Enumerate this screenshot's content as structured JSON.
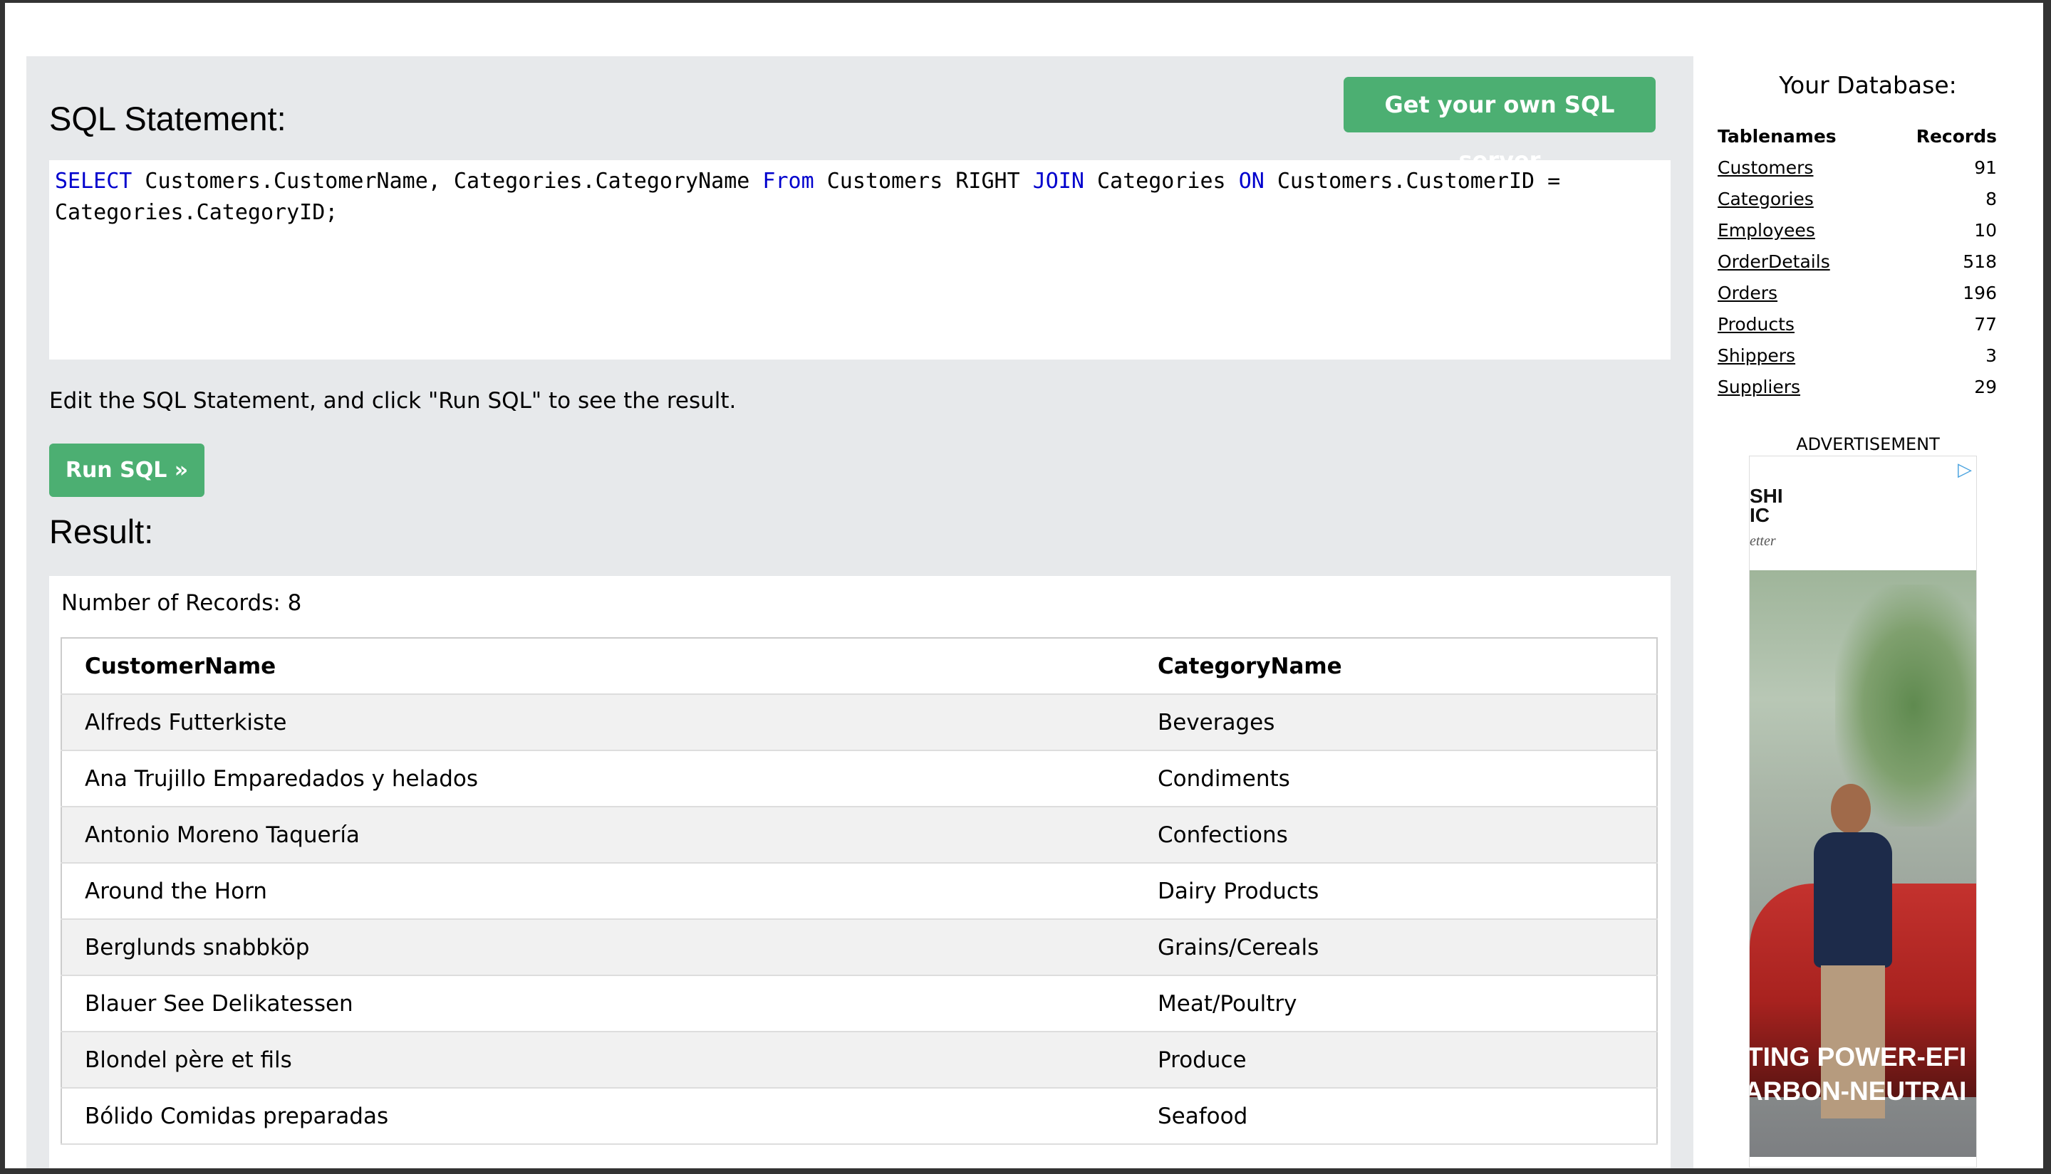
{
  "sql_section": {
    "heading": "SQL Statement:",
    "get_server_button": "Get your own SQL server",
    "query": {
      "kw_select": "SELECT",
      "t1": " Customers.CustomerName, Categories.CategoryName ",
      "kw_from": "From",
      "t2": " Customers RIGHT ",
      "kw_join": "JOIN",
      "t3": " Categories ",
      "kw_on": "ON",
      "t4": " Customers.CustomerID = Categories.CategoryID;"
    },
    "hint": "Edit the SQL Statement, and click \"Run SQL\" to see the result.",
    "run_button": "Run SQL »"
  },
  "result": {
    "heading": "Result:",
    "records_label": "Number of Records: 8",
    "columns": [
      "CustomerName",
      "CategoryName"
    ],
    "rows": [
      [
        "Alfreds Futterkiste",
        "Beverages"
      ],
      [
        "Ana Trujillo Emparedados y helados",
        "Condiments"
      ],
      [
        "Antonio Moreno Taquería",
        "Confections"
      ],
      [
        "Around the Horn",
        "Dairy Products"
      ],
      [
        "Berglunds snabbköp",
        "Grains/Cereals"
      ],
      [
        "Blauer See Delikatessen",
        "Meat/Poultry"
      ],
      [
        "Blondel père et fils",
        "Produce"
      ],
      [
        "Bólido Comidas preparadas",
        "Seafood"
      ]
    ]
  },
  "database": {
    "title": "Your Database:",
    "col_names": "Tablenames",
    "col_records": "Records",
    "tables": [
      {
        "name": "Customers",
        "records": "91"
      },
      {
        "name": "Categories",
        "records": "8"
      },
      {
        "name": "Employees",
        "records": "10"
      },
      {
        "name": "OrderDetails",
        "records": "518"
      },
      {
        "name": "Orders",
        "records": "196"
      },
      {
        "name": "Products",
        "records": "77"
      },
      {
        "name": "Shippers",
        "records": "3"
      },
      {
        "name": "Suppliers",
        "records": "29"
      }
    ]
  },
  "ad": {
    "label": "ADVERTISEMENT",
    "choice_icon": "▷",
    "top_line1": "SHI",
    "top_line2": "IC",
    "italic": "etter",
    "slogan_line1": "TING POWER-EFI",
    "slogan_line2": "ARBON-NEUTRAI"
  },
  "colors": {
    "button_green": "#4caf72",
    "keyword_blue": "#0000cd",
    "panel_gray": "#e7e9eb"
  }
}
